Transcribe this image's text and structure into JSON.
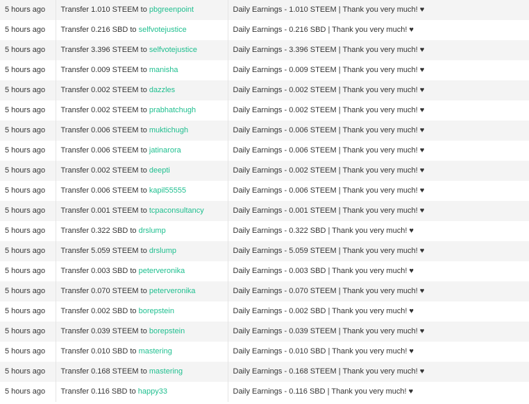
{
  "transfers": [
    {
      "time": "5 hours ago",
      "prefix": "Transfer 1.010 STEEM to ",
      "account": "pbgreenpoint",
      "memo": "Daily Earnings - 1.010 STEEM | Thank you very much! ♥"
    },
    {
      "time": "5 hours ago",
      "prefix": "Transfer 0.216 SBD to ",
      "account": "selfvotejustice",
      "memo": "Daily Earnings - 0.216 SBD | Thank you very much! ♥"
    },
    {
      "time": "5 hours ago",
      "prefix": "Transfer 3.396 STEEM to ",
      "account": "selfvotejustice",
      "memo": "Daily Earnings - 3.396 STEEM | Thank you very much! ♥"
    },
    {
      "time": "5 hours ago",
      "prefix": "Transfer 0.009 STEEM to ",
      "account": "manisha",
      "memo": "Daily Earnings - 0.009 STEEM | Thank you very much! ♥"
    },
    {
      "time": "5 hours ago",
      "prefix": "Transfer 0.002 STEEM to ",
      "account": "dazzles",
      "memo": "Daily Earnings - 0.002 STEEM | Thank you very much! ♥"
    },
    {
      "time": "5 hours ago",
      "prefix": "Transfer 0.002 STEEM to ",
      "account": "prabhatchugh",
      "memo": "Daily Earnings - 0.002 STEEM | Thank you very much! ♥"
    },
    {
      "time": "5 hours ago",
      "prefix": "Transfer 0.006 STEEM to ",
      "account": "muktichugh",
      "memo": "Daily Earnings - 0.006 STEEM | Thank you very much! ♥"
    },
    {
      "time": "5 hours ago",
      "prefix": "Transfer 0.006 STEEM to ",
      "account": "jatinarora",
      "memo": "Daily Earnings - 0.006 STEEM | Thank you very much! ♥"
    },
    {
      "time": "5 hours ago",
      "prefix": "Transfer 0.002 STEEM to ",
      "account": "deepti",
      "memo": "Daily Earnings - 0.002 STEEM | Thank you very much! ♥"
    },
    {
      "time": "5 hours ago",
      "prefix": "Transfer 0.006 STEEM to ",
      "account": "kapil55555",
      "memo": "Daily Earnings - 0.006 STEEM | Thank you very much! ♥"
    },
    {
      "time": "5 hours ago",
      "prefix": "Transfer 0.001 STEEM to ",
      "account": "tcpaconsultancy",
      "memo": "Daily Earnings - 0.001 STEEM | Thank you very much! ♥"
    },
    {
      "time": "5 hours ago",
      "prefix": "Transfer 0.322 SBD to ",
      "account": "drslump",
      "memo": "Daily Earnings - 0.322 SBD | Thank you very much! ♥"
    },
    {
      "time": "5 hours ago",
      "prefix": "Transfer 5.059 STEEM to ",
      "account": "drslump",
      "memo": "Daily Earnings - 5.059 STEEM | Thank you very much! ♥"
    },
    {
      "time": "5 hours ago",
      "prefix": "Transfer 0.003 SBD to ",
      "account": "peterveronika",
      "memo": "Daily Earnings - 0.003 SBD | Thank you very much! ♥"
    },
    {
      "time": "5 hours ago",
      "prefix": "Transfer 0.070 STEEM to ",
      "account": "peterveronika",
      "memo": "Daily Earnings - 0.070 STEEM | Thank you very much! ♥"
    },
    {
      "time": "5 hours ago",
      "prefix": "Transfer 0.002 SBD to ",
      "account": "borepstein",
      "memo": "Daily Earnings - 0.002 SBD | Thank you very much! ♥"
    },
    {
      "time": "5 hours ago",
      "prefix": "Transfer 0.039 STEEM to ",
      "account": "borepstein",
      "memo": "Daily Earnings - 0.039 STEEM | Thank you very much! ♥"
    },
    {
      "time": "5 hours ago",
      "prefix": "Transfer 0.010 SBD to ",
      "account": "mastering",
      "memo": "Daily Earnings - 0.010 SBD | Thank you very much! ♥"
    },
    {
      "time": "5 hours ago",
      "prefix": "Transfer 0.168 STEEM to ",
      "account": "mastering",
      "memo": "Daily Earnings - 0.168 STEEM | Thank you very much! ♥"
    },
    {
      "time": "5 hours ago",
      "prefix": "Transfer 0.116 SBD to ",
      "account": "happy33",
      "memo": "Daily Earnings - 0.116 SBD | Thank you very much! ♥"
    }
  ],
  "colors": {
    "link": "#1fbf8f",
    "row_stripe": "#f4f4f4",
    "text": "#333333"
  }
}
